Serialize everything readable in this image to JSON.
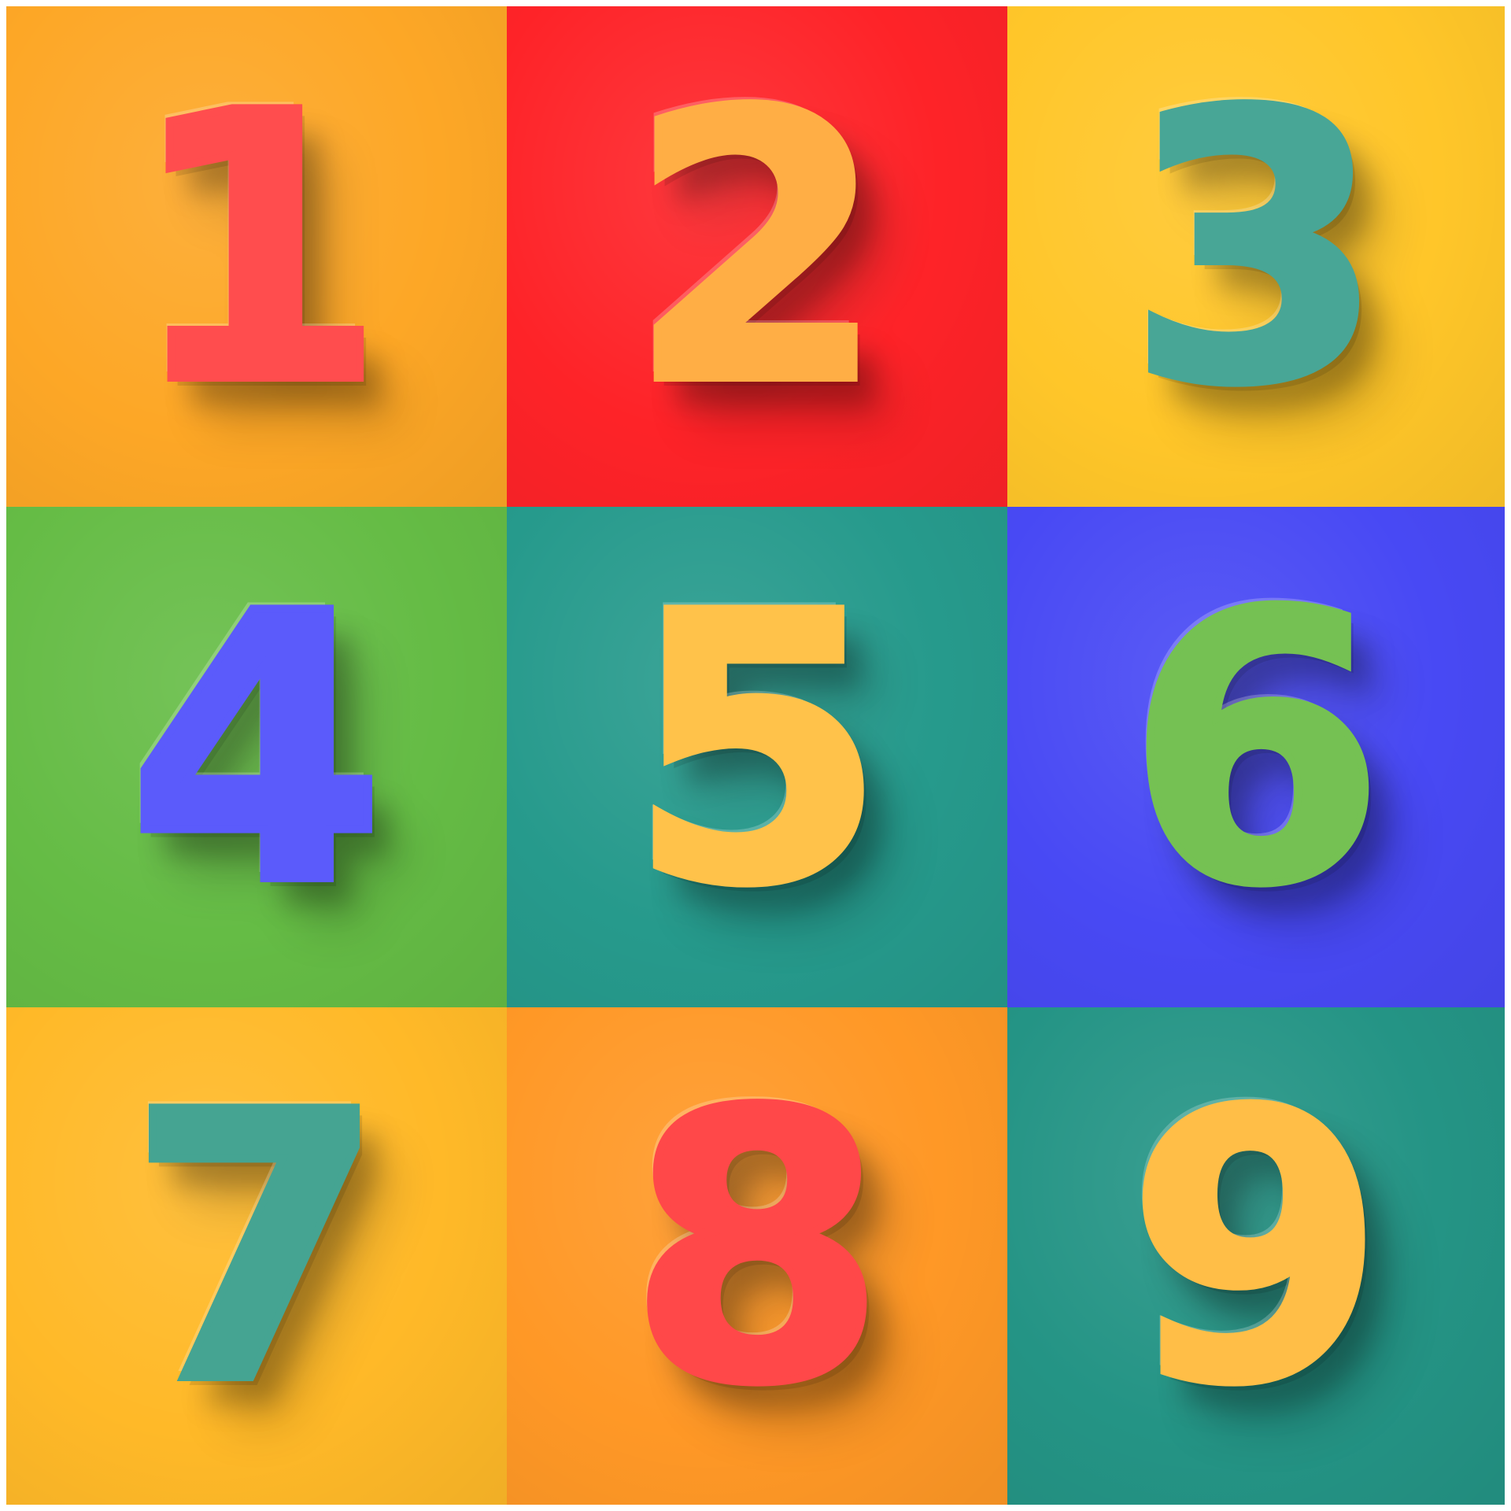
{
  "tiles": [
    {
      "digit": "1",
      "tile_color": "#FDA726",
      "digit_color": "#FF4D4E"
    },
    {
      "digit": "2",
      "tile_color": "#FE2328",
      "digit_color": "#FFAE45"
    },
    {
      "digit": "3",
      "tile_color": "#FFC629",
      "digit_color": "#48A696"
    },
    {
      "digit": "4",
      "tile_color": "#65BC45",
      "digit_color": "#5B5BFB"
    },
    {
      "digit": "5",
      "tile_color": "#269A8C",
      "digit_color": "#FFC24A"
    },
    {
      "digit": "6",
      "tile_color": "#4849F4",
      "digit_color": "#75C153"
    },
    {
      "digit": "7",
      "tile_color": "#FFB928",
      "digit_color": "#45A492"
    },
    {
      "digit": "8",
      "tile_color": "#FF9826",
      "digit_color": "#FF4849"
    },
    {
      "digit": "9",
      "tile_color": "#249485",
      "digit_color": "#FFBE47"
    }
  ]
}
